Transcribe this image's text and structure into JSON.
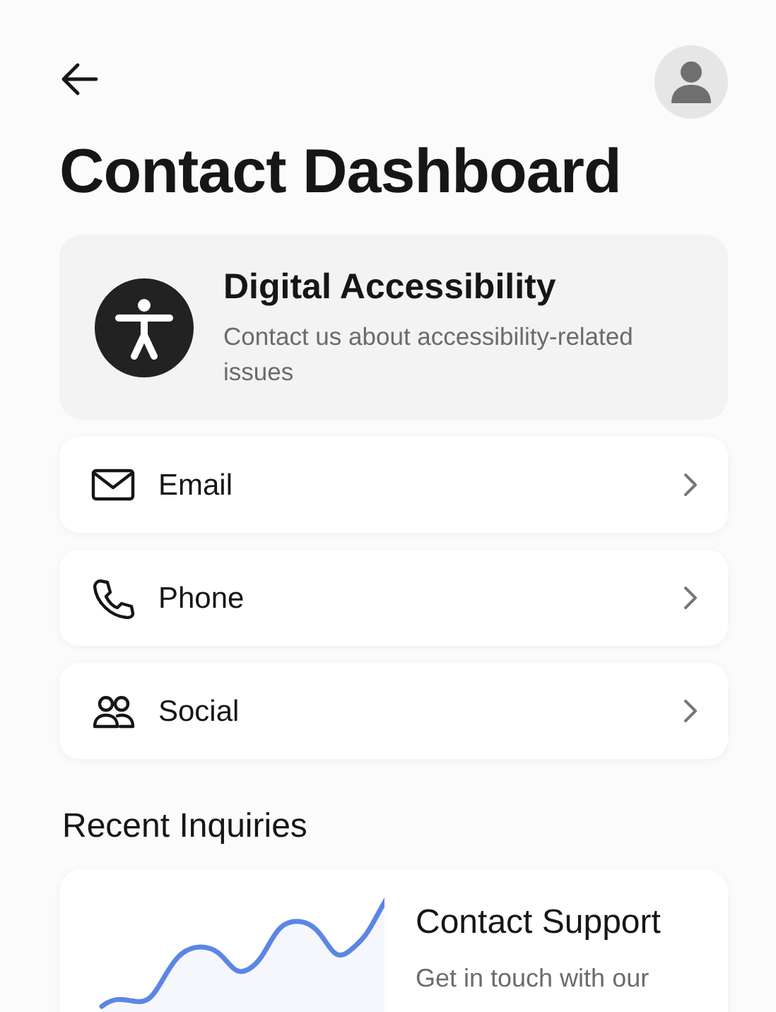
{
  "header": {
    "title": "Contact Dashboard"
  },
  "feature": {
    "title": "Digital Accessibility",
    "description": "Contact us about accessibility-related issues"
  },
  "contact_options": [
    {
      "label": "Email"
    },
    {
      "label": "Phone"
    },
    {
      "label": "Social"
    }
  ],
  "recent_inquiries": {
    "heading": "Recent Inquiries",
    "card": {
      "title": "Contact Support",
      "description": "Get in touch with our"
    }
  }
}
